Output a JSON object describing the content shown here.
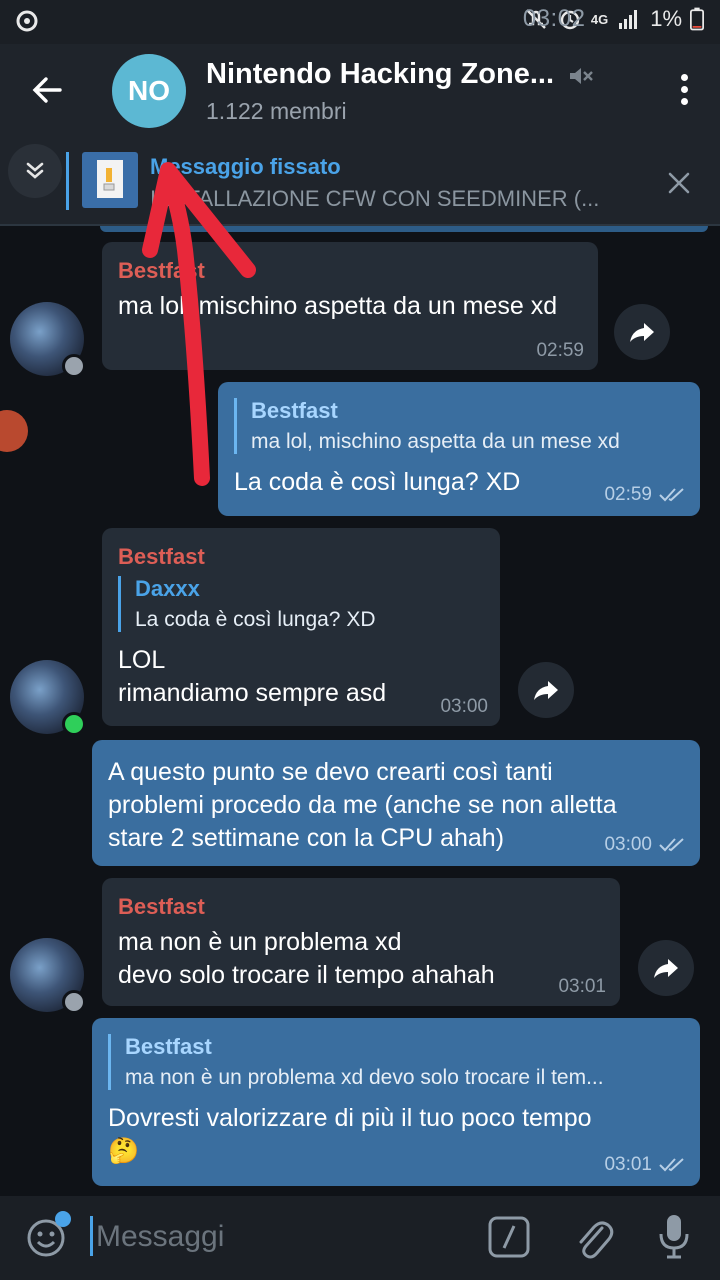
{
  "status_bar": {
    "network": "4G",
    "battery": "1%",
    "time": "03:02"
  },
  "header": {
    "avatar_initials": "NO",
    "title": "Nintendo Hacking Zone...",
    "subtitle": "1.122 membri"
  },
  "pinned": {
    "label": "Messaggio fissato",
    "text": "INSTALLAZIONE CFW CON SEEDMINER (..."
  },
  "messages": [
    {
      "direction": "in",
      "sender": "Bestfast",
      "text": "ma lol, mischino aspetta da un mese xd",
      "time": "02:59"
    },
    {
      "direction": "out",
      "reply_name": "Bestfast",
      "reply_text": "ma lol, mischino aspetta da un mese xd",
      "text": "La coda è così lunga? XD",
      "time": "02:59"
    },
    {
      "direction": "in",
      "sender": "Bestfast",
      "reply_name": "Daxxx",
      "reply_text": "La coda è così lunga? XD",
      "line1": "LOL",
      "line2": "rimandiamo sempre asd",
      "time": "03:00"
    },
    {
      "direction": "out",
      "line1": "A questo punto se devo crearti così tanti",
      "line2": "problemi procedo da me (anche se non alletta",
      "line3": "stare 2 settimane con la CPU ahah)",
      "time": "03:00"
    },
    {
      "direction": "in",
      "sender": "Bestfast",
      "line1": "ma non è un problema xd",
      "line2": "devo solo trocare il tempo ahahah",
      "time": "03:01"
    },
    {
      "direction": "out",
      "reply_name": "Bestfast",
      "reply_text": "ma non è un problema xd devo solo trocare il tem...",
      "text": "Dovresti valorizzare di più il tuo poco tempo",
      "emoji": "🤔",
      "time": "03:01"
    }
  ],
  "composer": {
    "placeholder": "Messaggi"
  },
  "colors": {
    "accent": "#4aa3e8",
    "sender_name": "#dd5e56",
    "outgoing_bubble": "#3a6e9f",
    "incoming_bubble": "#252d37",
    "online": "#2fcf5a",
    "annotation_arrow": "#e8283a"
  },
  "icons": [
    "alarm-off-icon",
    "alarm-icon",
    "signal-icon",
    "battery-icon",
    "back-arrow-icon",
    "mute-icon",
    "more-vert-icon",
    "chevrons-down-icon",
    "file-thumb-icon",
    "close-icon",
    "forward-icon",
    "emoji-icon",
    "command-slash-icon",
    "attach-icon",
    "mic-icon"
  ]
}
